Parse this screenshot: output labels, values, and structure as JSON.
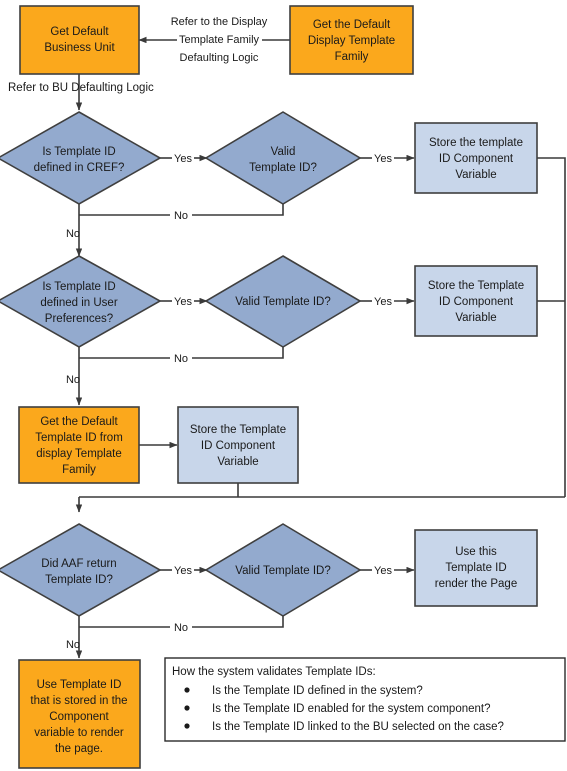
{
  "diagram": {
    "title": "Template ID defaulting logic flowchart",
    "colors": {
      "process_orange_fill": "#FBA81C",
      "process_orange_stroke": "#3f3f3f",
      "decision_blue_fill": "#93AACE",
      "decision_blue_stroke": "#3f3f3f",
      "store_blue_fill": "#C8D6EA",
      "store_blue_stroke": "#3f3f3f",
      "connector": "#3a3a3a",
      "note_border": "#2b2b2b",
      "text": "#1a1a1a",
      "background": "#ffffff"
    },
    "nodes": {
      "get_default_business_unit": {
        "shape": "process",
        "lines": [
          "Get Default",
          "Business Unit"
        ]
      },
      "get_the_default_display_template_family": {
        "shape": "process",
        "lines": [
          "Get the Default",
          "Display Template",
          "Family"
        ]
      },
      "is_template_id_defined_in_cref": {
        "shape": "decision",
        "lines": [
          "Is Template ID",
          "defined in CREF?"
        ]
      },
      "valid_template_id_1": {
        "shape": "decision",
        "lines": [
          "Valid",
          "Template ID?"
        ]
      },
      "store_the_template_id_component_variable": {
        "shape": "store",
        "lines": [
          "Store the template",
          "ID Component",
          "Variable"
        ]
      },
      "is_template_id_defined_in_user_preferences": {
        "shape": "decision",
        "lines": [
          "Is Template ID",
          "defined in User",
          "Preferences?"
        ]
      },
      "valid_template_id_2": {
        "shape": "decision",
        "lines": [
          "Valid Template ID?"
        ]
      },
      "store_the_template_id_component_variable_2": {
        "shape": "store",
        "lines": [
          "Store the Template",
          "ID Component",
          "Variable"
        ]
      },
      "get_the_default_template_id_from_display_template_family": {
        "shape": "process",
        "lines": [
          "Get the Default",
          "Template ID from",
          "display Template",
          "Family"
        ]
      },
      "store_the_template_id_component_variable_3": {
        "shape": "store",
        "lines": [
          "Store the Template",
          "ID Component",
          "Variable"
        ]
      },
      "did_aaf_return_template_id": {
        "shape": "decision",
        "lines": [
          "Did AAF return",
          "Template ID?"
        ]
      },
      "valid_template_id_3": {
        "shape": "decision",
        "lines": [
          "Valid Template ID?"
        ]
      },
      "use_this_template_id_render_the_page": {
        "shape": "store",
        "lines": [
          "Use this",
          "Template ID",
          "render the Page"
        ]
      },
      "use_template_id_stored_in_component_variable": {
        "shape": "process",
        "lines": [
          "Use Template ID",
          "that is stored in the",
          "Component",
          "variable to render",
          "the page."
        ]
      }
    },
    "edge_labels": {
      "refer_display_template_family": [
        "Refer to the Display",
        "Template Family",
        "Defaulting Logic"
      ],
      "refer_bu_defaulting_logic": "Refer to BU Defaulting Logic",
      "yes_1": "Yes",
      "yes_2": "Yes",
      "no_horizontal_1": "No",
      "no_down_1": "No",
      "yes_3": "Yes",
      "yes_4": "Yes",
      "no_horizontal_2": "No",
      "no_down_2": "No",
      "yes_5": "Yes",
      "yes_6": "Yes",
      "no_horizontal_3": "No",
      "no_down_3": "No"
    },
    "note": {
      "heading": "How the system validates Template IDs:",
      "bullets": [
        "Is the Template ID defined in the system?",
        "Is the Template ID enabled for the system component?",
        "Is the Template ID linked to the BU selected on the case?"
      ]
    }
  }
}
